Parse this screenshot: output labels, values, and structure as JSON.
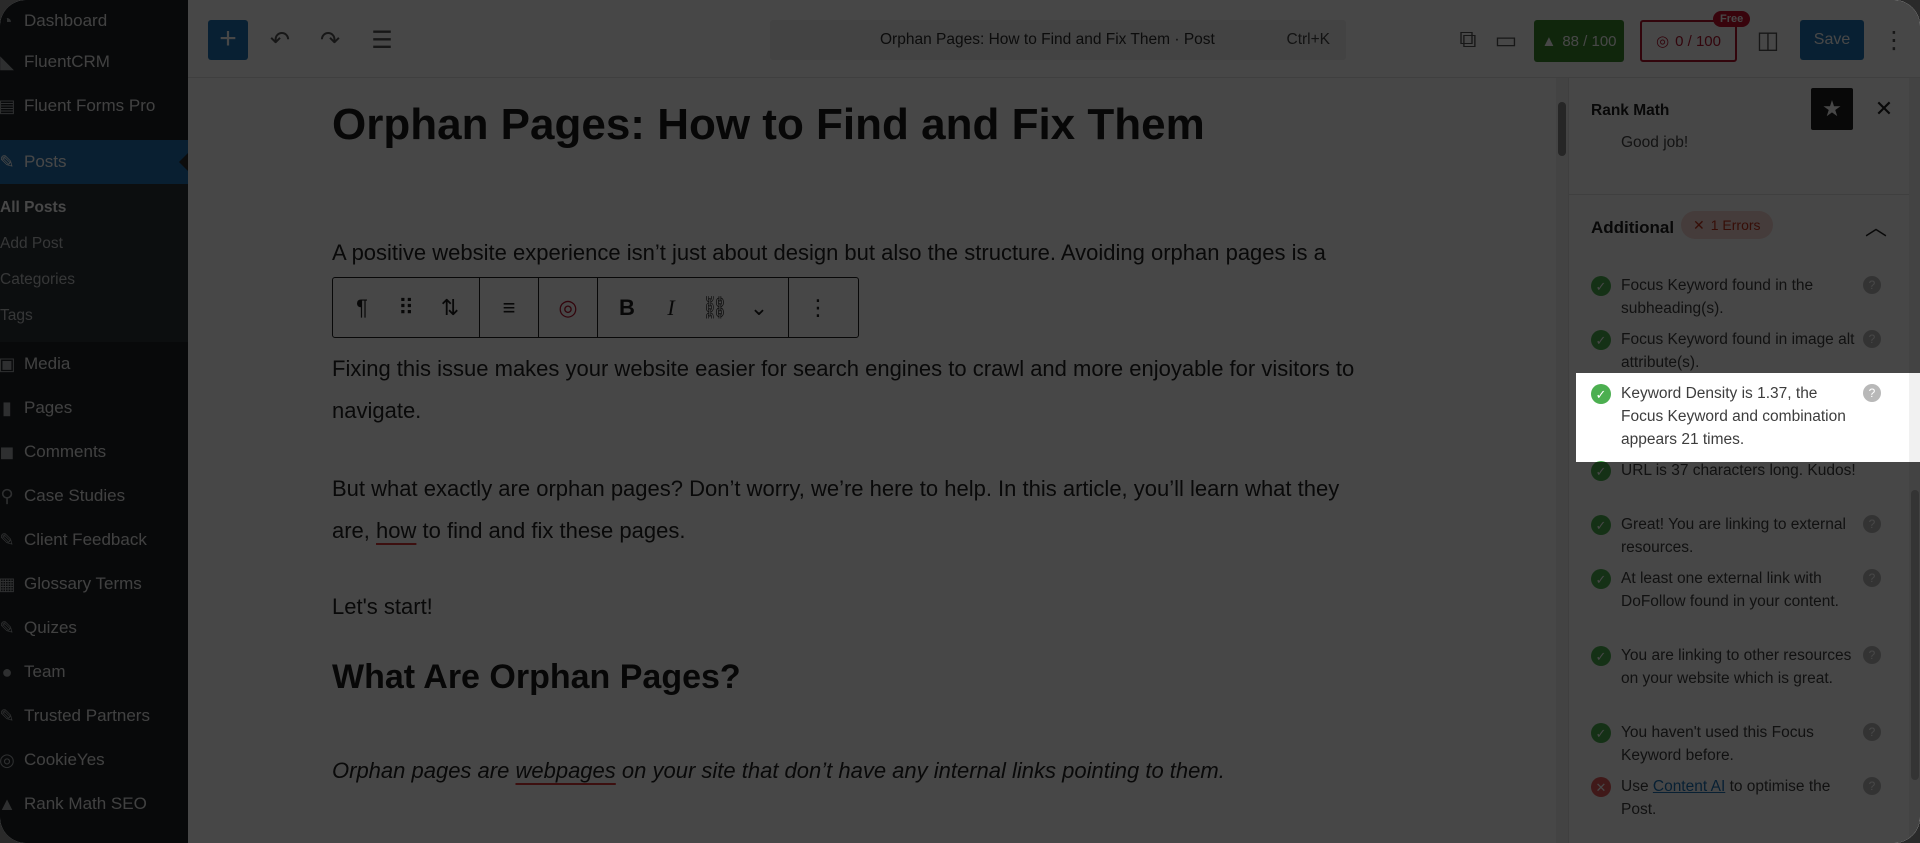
{
  "sidebar": {
    "items": [
      {
        "label": "Dashboard",
        "icon": "dashboard-icon"
      },
      {
        "label": "FluentCRM",
        "icon": "fluentcrm-icon"
      },
      {
        "label": "Fluent Forms Pro",
        "icon": "forms-icon"
      },
      {
        "label": "Posts",
        "icon": "pin-icon"
      },
      {
        "label": "Media",
        "icon": "media-icon"
      },
      {
        "label": "Pages",
        "icon": "pages-icon"
      },
      {
        "label": "Comments",
        "icon": "comments-icon"
      },
      {
        "label": "Case Studies",
        "icon": "search-icon"
      },
      {
        "label": "Client Feedback",
        "icon": "pin-icon"
      },
      {
        "label": "Glossary Terms",
        "icon": "glossary-icon"
      },
      {
        "label": "Quizes",
        "icon": "pin-icon"
      },
      {
        "label": "Team",
        "icon": "team-icon"
      },
      {
        "label": "Trusted Partners",
        "icon": "pin-icon"
      },
      {
        "label": "CookieYes",
        "icon": "cookie-icon"
      },
      {
        "label": "Rank Math SEO",
        "icon": "rankmath-icon"
      }
    ],
    "posts_sub": [
      "All Posts",
      "Add Post",
      "Categories",
      "Tags"
    ]
  },
  "topbar": {
    "doc_title": "Orphan Pages: How to Find and Fix Them · Post",
    "shortcut": "Ctrl+K",
    "seo_score": "88 / 100",
    "content_ai_score": "0 / 100",
    "free_badge": "Free",
    "save_label": "Save"
  },
  "document": {
    "title": "Orphan Pages: How to Find and Fix Them",
    "p1": "A positive website experience isn’t just about design but also the structure. Avoiding orphan pages is a",
    "p2a": "Fixing this issue makes your website easier for search engines to crawl and more enjoyable for visitors to",
    "p2b": "navigate.",
    "p3a": "But what exactly are orphan pages? Don’t worry, we’re here to help. In this article, you’ll learn what they",
    "p3b_pre": "are, ",
    "p3b_link": "how",
    "p3b_post": " to find and fix these pages.",
    "p4": "Let's start!",
    "h2": "What Are Orphan Pages?",
    "p5_pre": "Orphan pages are ",
    "p5_link": "webpages",
    "p5_post": " on your site that don’t have any internal links pointing to them."
  },
  "panel": {
    "title": "Rank Math",
    "good_job": "Good job!",
    "section": "Additional",
    "errors": "1 Errors",
    "checks": [
      {
        "status": "ok",
        "text": "Focus Keyword found in the subheading(s)."
      },
      {
        "status": "ok",
        "text": "Focus Keyword found in image alt attribute(s)."
      },
      {
        "status": "ok",
        "text": "Keyword Density is 1.37, the Focus Keyword and combination appears 21 times."
      },
      {
        "status": "ok",
        "text": "URL is 37 characters long. Kudos!"
      },
      {
        "status": "ok",
        "text": "Great! You are linking to external resources."
      },
      {
        "status": "ok",
        "text": "At least one external link with DoFollow found in your content."
      },
      {
        "status": "ok",
        "text": "You are linking to other resources on your website which is great."
      },
      {
        "status": "ok",
        "text": "You haven't used this Focus Keyword before."
      }
    ],
    "last_check": {
      "status": "error",
      "pre": "Use ",
      "link": "Content AI",
      "post": " to optimise the Post."
    }
  },
  "colors": {
    "accent": "#1e74b7",
    "seo_green": "#3c8a2e",
    "error_red": "#c8102e",
    "sidebar_bg": "#1d2327"
  }
}
